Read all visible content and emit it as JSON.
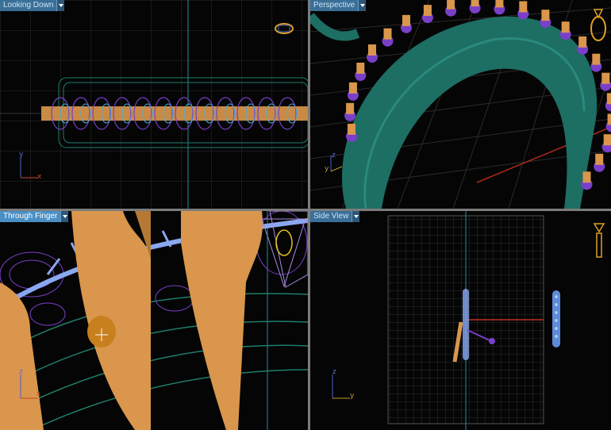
{
  "viewports": {
    "top_left": {
      "label": "Looking Down",
      "axis_v": "y",
      "axis_h": "x"
    },
    "top_right": {
      "label": "Perspective",
      "axis_v": "z",
      "axis_h": "y"
    },
    "bottom_left": {
      "label": "Through Finger",
      "axis_v": "z",
      "axis_h": "x"
    },
    "bottom_right": {
      "label": "Side View",
      "axis_v": "z",
      "axis_h": "y"
    }
  },
  "icons": {
    "camera": "ring-camera-icon",
    "menu": "chevron-down-icon"
  },
  "colors": {
    "grid": "#2e2e2e",
    "ring_green": "#1f6d5e",
    "wire_cyan": "#4ab0b8",
    "prong_gold": "#d9964c",
    "bead_purple": "#7a3fc9",
    "axis_cyan": "#2fa6b6",
    "axis_red": "#c0301c"
  }
}
